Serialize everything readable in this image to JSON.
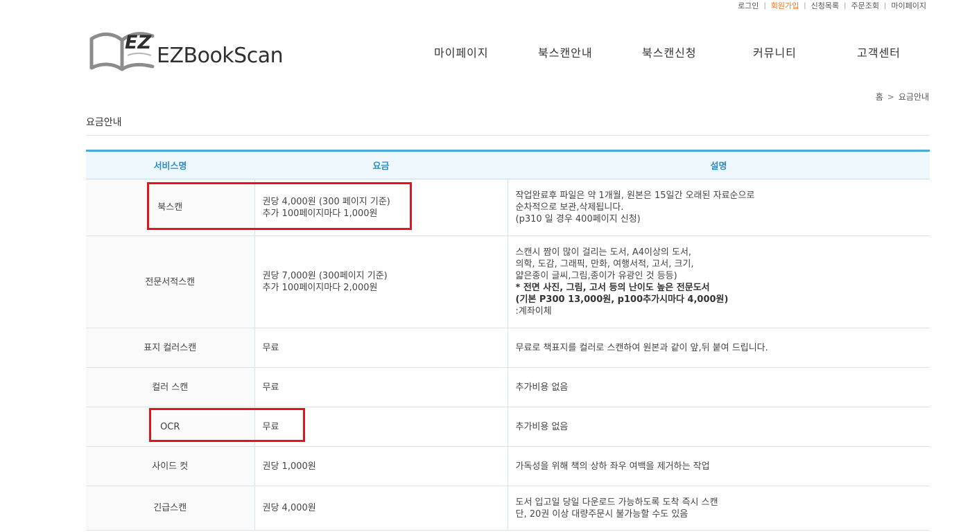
{
  "util_nav": {
    "items": [
      {
        "label": "로그인",
        "accent": false
      },
      {
        "label": "회원가입",
        "accent": true
      },
      {
        "label": "신청목록",
        "accent": false
      },
      {
        "label": "주문조회",
        "accent": false
      },
      {
        "label": "마이페이지",
        "accent": false
      }
    ],
    "separator": "|"
  },
  "logo": {
    "mark": "EZ",
    "brand": "EZBookScan"
  },
  "gnb": {
    "items": [
      "마이페이지",
      "북스캔안내",
      "북스캔신청",
      "커뮤니티",
      "고객센터"
    ]
  },
  "breadcrumb": {
    "home": "홈",
    "arrow": ">",
    "current": "요금안내"
  },
  "page_title": "요금안내",
  "table": {
    "headers": [
      "서비스명",
      "요금",
      "설명"
    ],
    "rows": [
      {
        "name": "북스캔",
        "fee": [
          "권당 4,000원 (300 페이지 기준)",
          "추가 100페이지마다 1,000원"
        ],
        "desc": [
          {
            "text": "작업완료후 파일은 약 1개월, 원본은 15일간 오래된 자료순으로",
            "bold": false
          },
          {
            "text": "순차적으로 보관,삭제됩니다.",
            "bold": false
          },
          {
            "text": "(p310 일 경우 400페이지 신청)",
            "bold": false
          }
        ]
      },
      {
        "name": "전문서적스캔",
        "fee": [
          "권당 7,000원 (300페이지 기준)",
          "추가 100페이지마다 2,000원"
        ],
        "desc": [
          {
            "text": "스캔시 짬이 많이 걸리는 도서, A4이상의 도서,",
            "bold": false
          },
          {
            "text": "의학, 도감, 그래픽, 만화, 여행서적, 고서, 크기,",
            "bold": false
          },
          {
            "text": "얇은종이 글씨,그림,종이가 유광인 것 등등)",
            "bold": false
          },
          {
            "text": "* 전면 사진, 그림, 고서 등의 난이도 높은 전문도서",
            "bold": true
          },
          {
            "text": "(기본 P300 13,000원, p100추가시마다 4,000원)",
            "bold": true
          },
          {
            "text": ":계좌이체",
            "bold": false
          }
        ]
      },
      {
        "name": "표지 컬러스캔",
        "fee": [
          "무료"
        ],
        "desc": [
          {
            "text": "무료로 책표지를 컬러로 스캔하여 원본과 같이 앞,뒤 붙여 드립니다.",
            "bold": false
          }
        ]
      },
      {
        "name": "컬러 스캔",
        "fee": [
          "무료"
        ],
        "desc": [
          {
            "text": "추가비용 없음",
            "bold": false
          }
        ]
      },
      {
        "name": "OCR",
        "fee": [
          "무료"
        ],
        "desc": [
          {
            "text": "추가비용 없음",
            "bold": false
          }
        ]
      },
      {
        "name": "사이드 컷",
        "fee": [
          "권당 1,000원"
        ],
        "desc": [
          {
            "text": "가독성을 위해 책의 상하 좌우 여백을 제거하는 작업",
            "bold": false
          }
        ]
      },
      {
        "name": "긴급스캔",
        "fee": [
          "권당 4,000원"
        ],
        "desc": [
          {
            "text": "도서 입고일 당일 다운로드 가능하도록 도착 즉시 스캔",
            "bold": false
          },
          {
            "text": "단, 20권 이상 대량주문시 불가능할 수도 있음",
            "bold": false
          }
        ]
      }
    ]
  },
  "colors": {
    "accent_link": "#e87722",
    "table_header_text": "#2f8ec4",
    "table_top_border": "#4baad3",
    "table_header_bg": "#eef7fb",
    "highlight_box": "#e3121c"
  }
}
